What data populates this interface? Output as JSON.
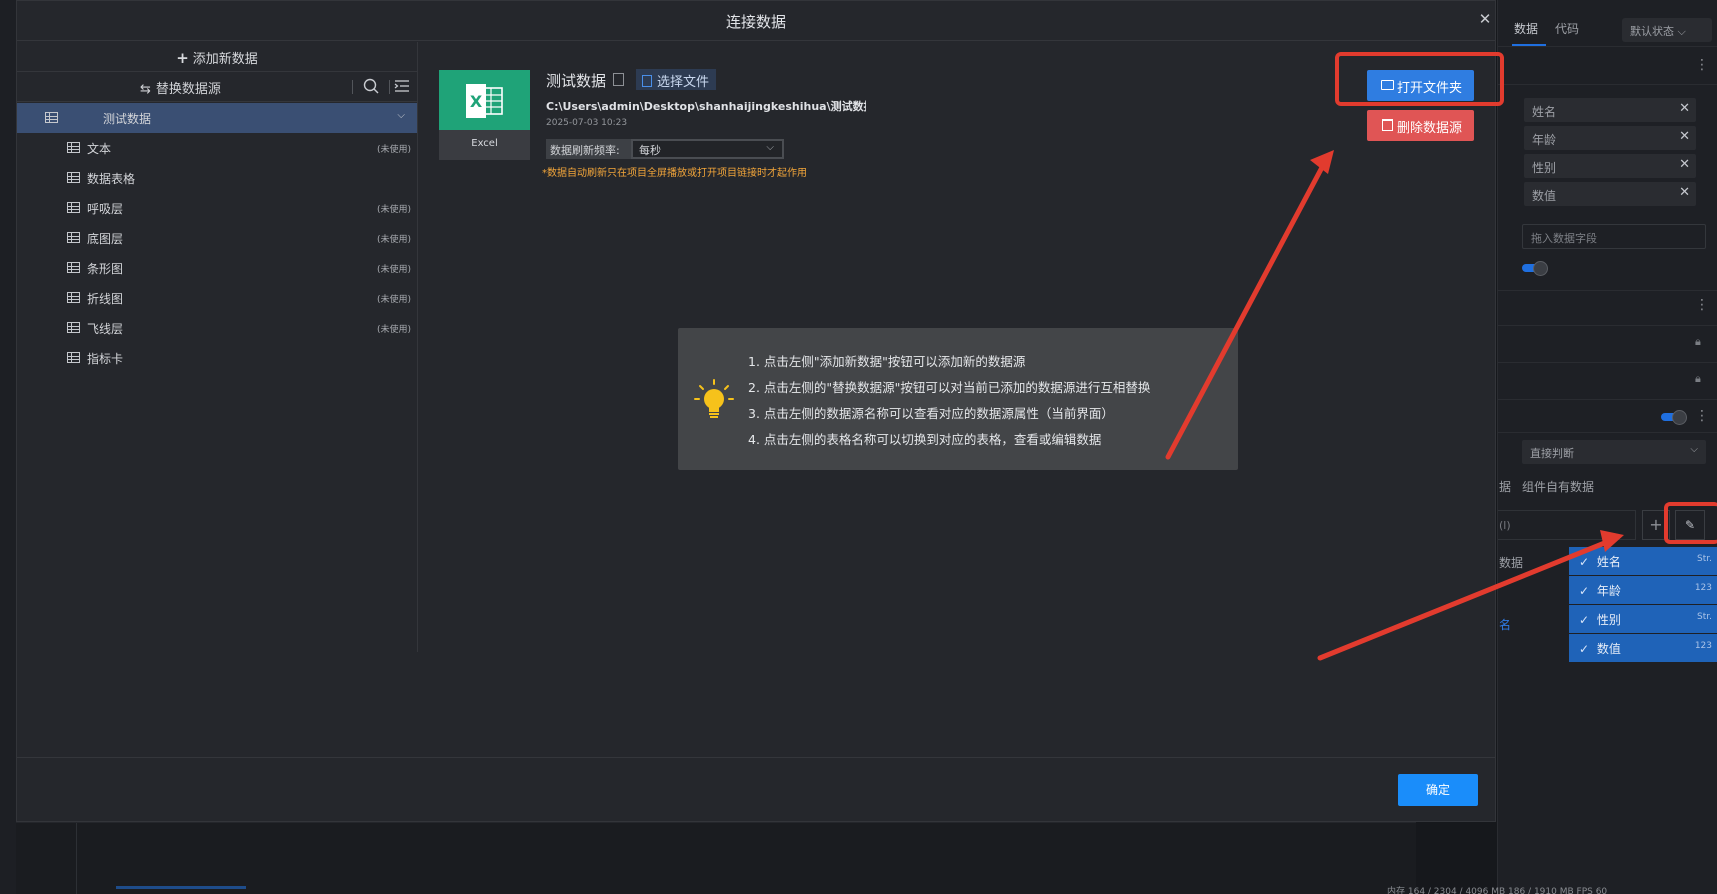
{
  "modal": {
    "title": "连接数据",
    "add_new": "添加新数据",
    "replace_source": "替换数据源",
    "tree": {
      "root": "测试数据",
      "children": [
        {
          "label": "文本",
          "status": "(未使用)"
        },
        {
          "label": "数据表格",
          "status": ""
        },
        {
          "label": "呼吸层",
          "status": "(未使用)"
        },
        {
          "label": "底图层",
          "status": "(未使用)"
        },
        {
          "label": "条形图",
          "status": "(未使用)"
        },
        {
          "label": "折线图",
          "status": "(未使用)"
        },
        {
          "label": "飞线层",
          "status": "(未使用)"
        },
        {
          "label": "指标卡",
          "status": ""
        }
      ]
    },
    "source": {
      "type_label": "Excel",
      "name": "测试数据",
      "choose_file": "选择文件",
      "path": "C:\\Users\\admin\\Desktop\\shanhaijingkeshihua\\测试数据.x...",
      "time": "2025-07-03 10:23",
      "refresh_label": "数据刷新频率:",
      "refresh_value": "每秒",
      "refresh_note": "*数据自动刷新只在项目全屏播放或打开项目链接时才起作用",
      "open_folder": "打开文件夹",
      "delete_source": "删除数据源"
    },
    "tips": [
      "1. 点击左侧\"添加新数据\"按钮可以添加新的数据源",
      "2. 点击左侧的\"替换数据源\"按钮可以对当前已添加的数据源进行互相替换",
      "3. 点击左侧的数据源名称可以查看对应的数据源属性（当前界面）",
      "4. 点击左侧的表格名称可以切换到对应的表格，查看或编辑数据"
    ],
    "ok": "确定"
  },
  "right_panel": {
    "tab_data": "数据",
    "tab_code": "代码",
    "state": "默认状态",
    "fields": [
      "姓名",
      "年龄",
      "性别",
      "数值"
    ],
    "drop_placeholder": "拖入数据字段",
    "judge": "直接判断",
    "own_data": "组件自有数据",
    "small_label": "据",
    "hint": "(l)",
    "mid_label": "数据",
    "mid_link": "名",
    "columns": [
      {
        "name": "姓名",
        "type": "Str."
      },
      {
        "name": "年龄",
        "type": "123"
      },
      {
        "name": "性别",
        "type": "Str."
      },
      {
        "name": "数值",
        "type": "123"
      }
    ]
  },
  "status_bar": "内存   164 / 2304 / 4096 MB  186 / 1910 MB      FPS   60",
  "colors": {
    "accent": "#1a8dfa",
    "danger": "#e05555",
    "annotation": "#e23b2e",
    "excel": "#1fa378"
  }
}
